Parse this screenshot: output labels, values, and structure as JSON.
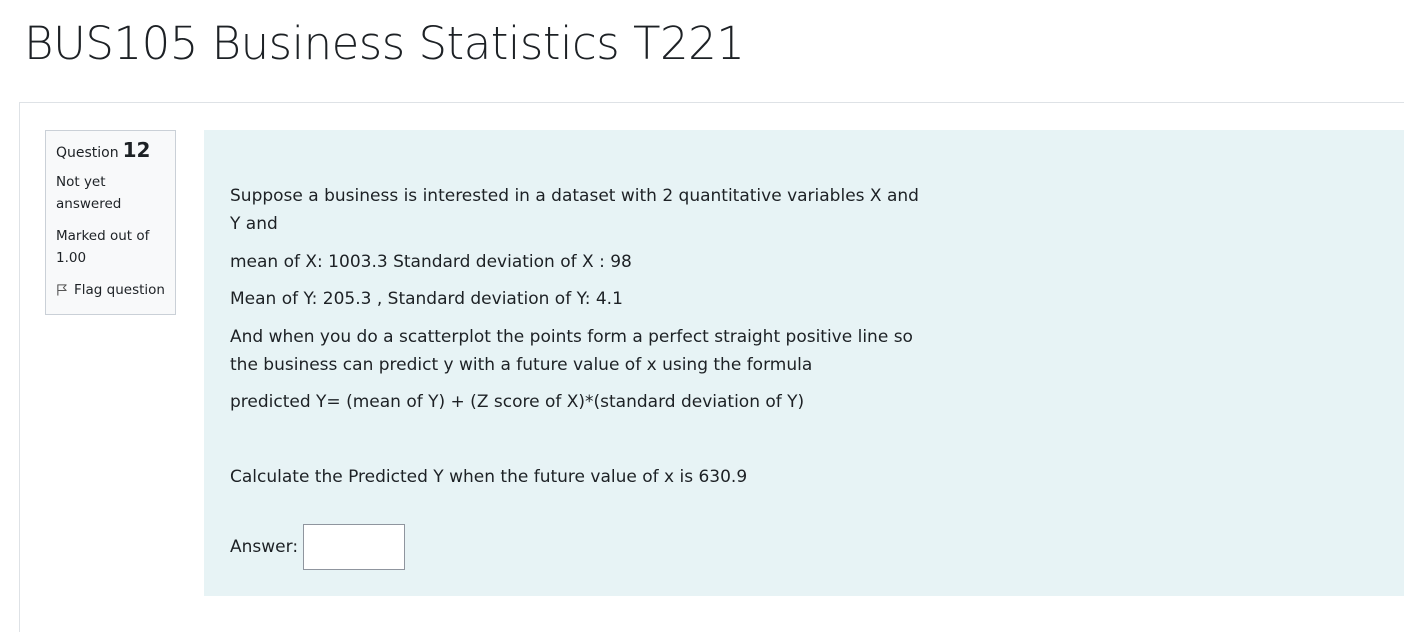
{
  "page": {
    "title": "BUS105 Business Statistics T221"
  },
  "question_info": {
    "label": "Question",
    "number": "12",
    "state": "Not yet answered",
    "grade": "Marked out of 1.00",
    "flag_label": "Flag question",
    "flag_icon": "flag-outline-icon"
  },
  "question_text": {
    "line1": "Suppose a business is interested in a dataset with 2 quantitative variables X and Y and",
    "line2": "mean of X: 1003.3 Standard deviation of X : 98",
    "line3": "Mean of Y: 205.3 , Standard deviation of Y: 4.1",
    "line4": "And when you do a scatterplot the points form a  perfect straight positive  line so the business can predict y with a future value of x using the formula",
    "line5": "predicted Y= (mean of Y) +  (Z score of X)*(standard deviation of Y)",
    "line6": "Calculate the Predicted Y when  the future value of x is   630.9"
  },
  "answer": {
    "label": "Answer:",
    "value": ""
  },
  "colors": {
    "content_background": "#e7f3f5",
    "info_background": "#f8f9fa",
    "text": "#1d2125"
  }
}
